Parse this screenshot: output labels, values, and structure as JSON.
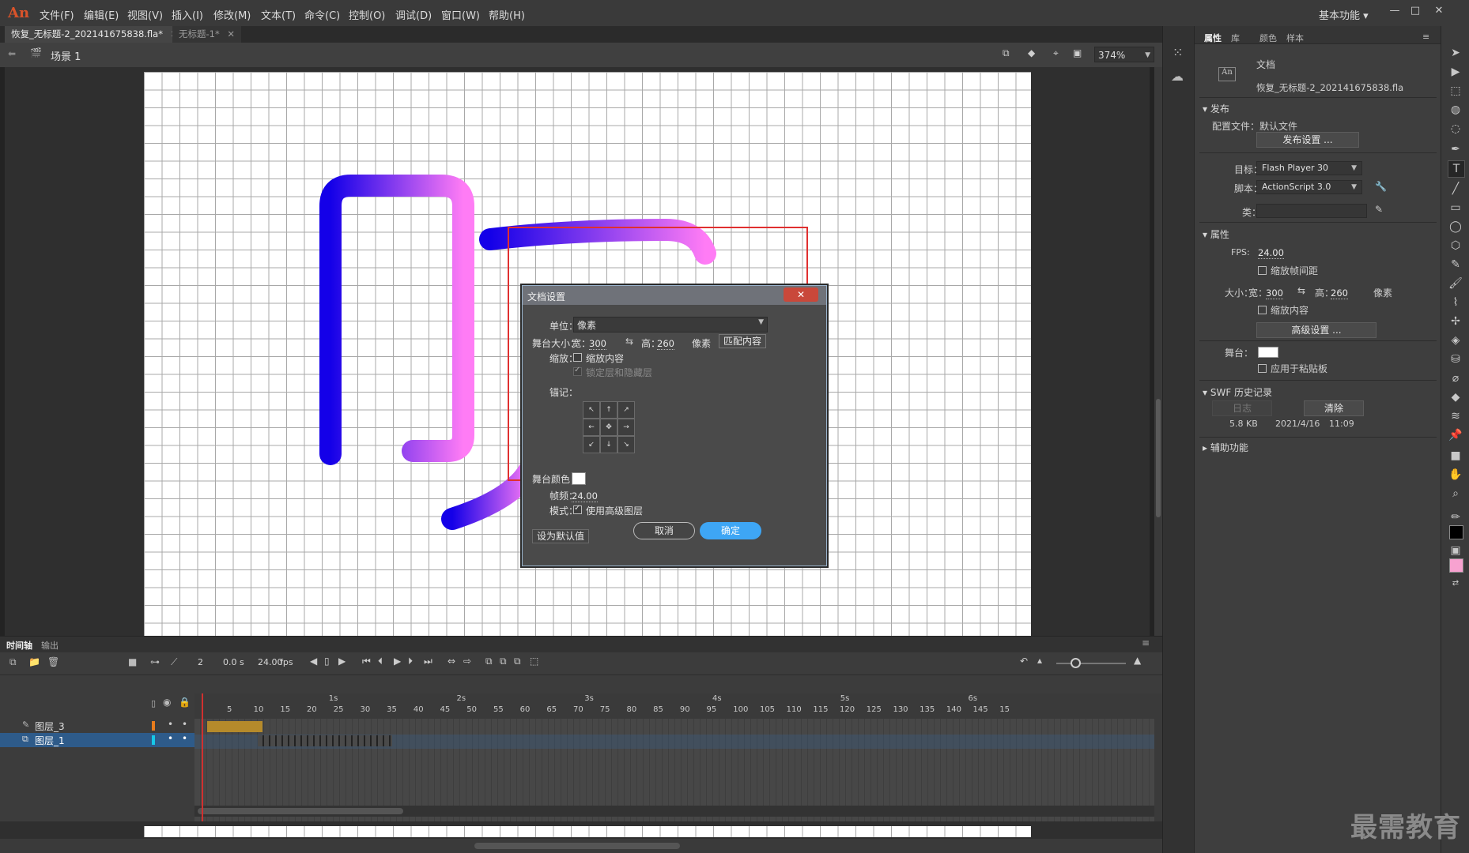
{
  "app": {
    "logo": "An",
    "menu": [
      "文件(F)",
      "编辑(E)",
      "视图(V)",
      "插入(I)",
      "修改(M)",
      "文本(T)",
      "命令(C)",
      "控制(O)",
      "调试(D)",
      "窗口(W)",
      "帮助(H)"
    ],
    "workspace": "基本功能 ▾",
    "window_controls": [
      "—",
      "□",
      "✕"
    ]
  },
  "tabs": [
    {
      "label": "恢复_无标题-2_202141675838.fla*",
      "close": "✕"
    },
    {
      "label": "无标题-1*",
      "close": "✕"
    }
  ],
  "scene": {
    "name": "场景 1",
    "zoom": "374%"
  },
  "dialog": {
    "title": "文档设置",
    "close_icon": "✕",
    "units_label": "单位：",
    "units_value": "像素",
    "stage_size_label": "舞台大小：",
    "width_label": "宽：",
    "width_value": "300",
    "height_label": "高：",
    "height_value": "260",
    "px_label": "像素",
    "match_button": "匹配内容",
    "scale_label": "缩放：",
    "scale_content": "缩放内容",
    "lock_hidden": "锁定层和隐藏层",
    "anchor_label": "锚记：",
    "stage_color_label": "舞台颜色：",
    "fps_label": "帧频：",
    "fps_value": "24.00",
    "mode_label": "模式：",
    "advanced_layers": "使用高级图层",
    "default_button": "设为默认值",
    "cancel_button": "取消",
    "ok_button": "确定"
  },
  "properties": {
    "tabs": [
      "属性",
      "库",
      "颜色",
      "样本"
    ],
    "doc_icon": "An",
    "doc_label": "文档",
    "file_name": "恢复_无标题-2_202141675838.fla",
    "publish_section": "发布",
    "profile_label": "配置文件：默认文件",
    "publish_settings_button": "发布设置 ...",
    "target_label": "目标：",
    "target_value": "Flash Player 30",
    "script_label": "脚本：",
    "script_value": "ActionScript 3.0",
    "class_label": "类：",
    "props_section": "属性",
    "fps_label": "FPS:",
    "fps_value": "24.00",
    "scale_spans": "缩放帧间距",
    "size_label": "大小：",
    "w_label": "宽：",
    "w_value": "300",
    "h_label": "高：",
    "h_value": "260",
    "px_label": "像素",
    "scale_content": "缩放内容",
    "advanced_button": "高级设置 ...",
    "stage_label": "舞台：",
    "apply_paste": "应用于粘贴板",
    "swf_section": "SWF 历史记录",
    "log_button": "日志",
    "clear_button": "清除",
    "history": {
      "size": "5.8 KB",
      "date": "2021/4/16",
      "time": "11:09"
    },
    "accessibility_section": "辅助功能"
  },
  "timeline": {
    "tabs": [
      "时间轴",
      "输出"
    ],
    "current_frame": "2",
    "time": "0.0 s",
    "fps": "24.00",
    "fps_unit": "fps",
    "layers": [
      "图层_3",
      "图层_1"
    ],
    "ruler_numbers": [
      "5",
      "10",
      "15",
      "20",
      "25",
      "30",
      "35",
      "40",
      "45",
      "50",
      "55",
      "60",
      "65",
      "70",
      "75",
      "80",
      "85",
      "90",
      "95",
      "100",
      "105",
      "110",
      "115",
      "120",
      "125",
      "130",
      "135",
      "140",
      "145",
      "15"
    ],
    "ruler_seconds": [
      "1s",
      "2s",
      "3s",
      "4s",
      "5s",
      "6s"
    ]
  },
  "colors": {
    "gradient_start": "#1400e8",
    "gradient_end": "#ff7cf5",
    "highlight_box": "#e03030",
    "ok_button": "#3ea6f5",
    "fill_swatch": "#f7a2d0"
  },
  "watermark": "最需教育"
}
